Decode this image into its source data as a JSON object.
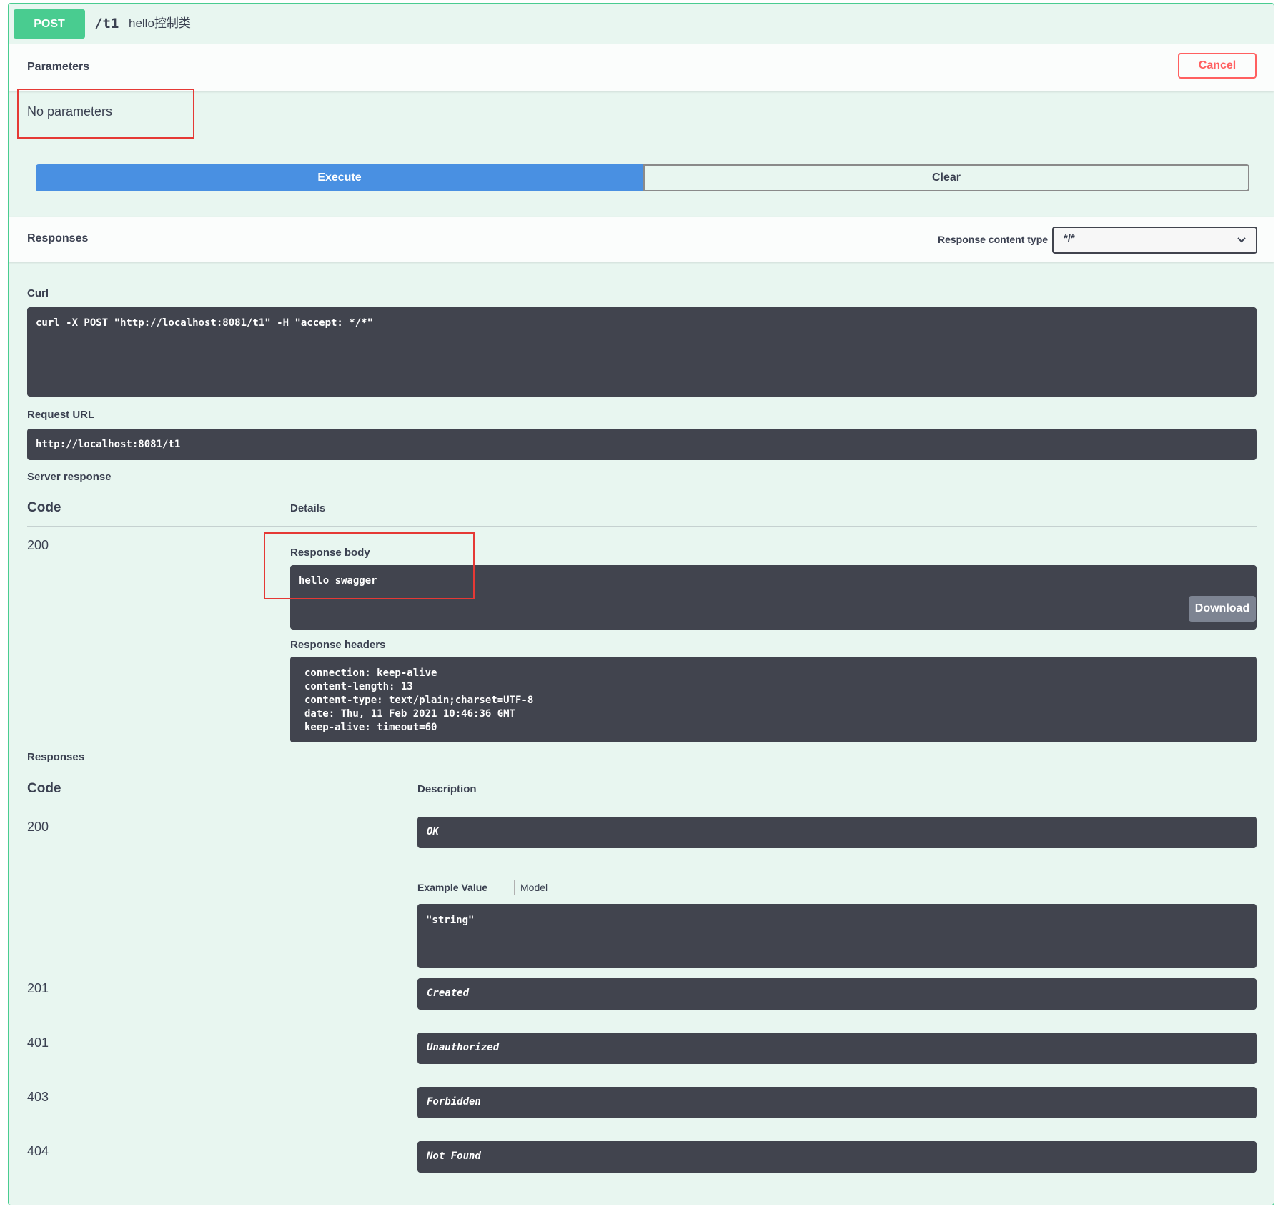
{
  "operation": {
    "method": "POST",
    "path": "/t1",
    "summary": "hello控制类"
  },
  "parameters": {
    "title": "Parameters",
    "cancel_label": "Cancel",
    "empty_text": "No parameters"
  },
  "actions": {
    "execute_label": "Execute",
    "clear_label": "Clear"
  },
  "responses_header": {
    "title": "Responses",
    "content_type_label": "Response content type",
    "content_type_value": "*/*"
  },
  "curl": {
    "label": "Curl",
    "command": "curl -X POST \"http://localhost:8081/t1\" -H \"accept: */*\""
  },
  "request_url": {
    "label": "Request URL",
    "value": "http://localhost:8081/t1"
  },
  "server_response": {
    "label": "Server response",
    "code_header": "Code",
    "details_header": "Details",
    "code": "200",
    "body_label": "Response body",
    "body": "hello swagger",
    "download_label": "Download",
    "headers_label": "Response headers",
    "headers": [
      "connection: keep-alive",
      "content-length: 13",
      "content-type: text/plain;charset=UTF-8",
      "date: Thu, 11 Feb 2021 10:46:36 GMT",
      "keep-alive: timeout=60"
    ]
  },
  "responses": {
    "label": "Responses",
    "code_header": "Code",
    "description_header": "Description",
    "example_tab": "Example Value",
    "model_tab": "Model",
    "example_value": "\"string\"",
    "rows": [
      {
        "code": "200",
        "description": "OK"
      },
      {
        "code": "201",
        "description": "Created"
      },
      {
        "code": "401",
        "description": "Unauthorized"
      },
      {
        "code": "403",
        "description": "Forbidden"
      },
      {
        "code": "404",
        "description": "Not Found"
      }
    ]
  },
  "colors": {
    "post_green": "#49cc90",
    "execute_blue": "#4990e2",
    "cancel_red": "#ff6060",
    "code_bg": "#41444e",
    "panel_bg": "#e8f6f0",
    "highlight_red": "#e53935"
  },
  "icons": {
    "select_arrow": "chevron-down-icon"
  }
}
